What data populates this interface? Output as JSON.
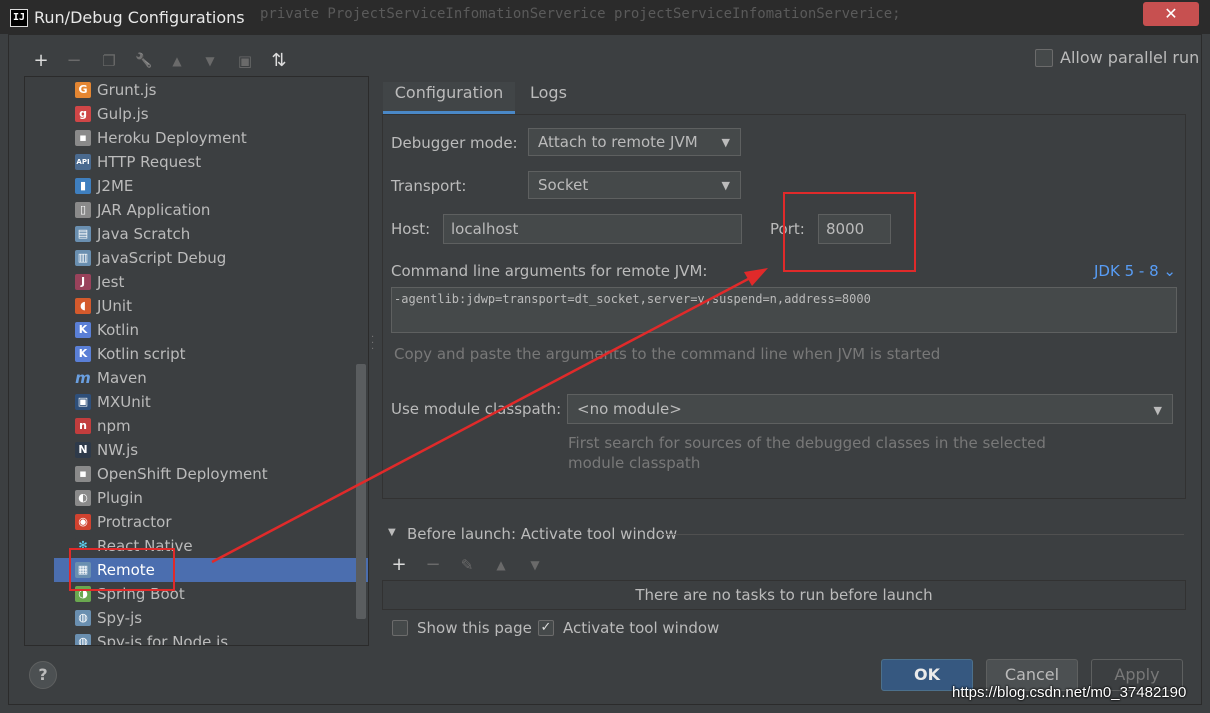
{
  "window": {
    "title": "Run/Debug Configurations",
    "app_icon": "IJ",
    "background_code_text": "private ProjectServiceInfomationServerice projectServiceInfomationServerice;",
    "close": "✕"
  },
  "toolbar": {
    "icons": [
      "add-icon",
      "remove-icon",
      "copy-icon",
      "wrench-icon",
      "move-up-icon",
      "move-down-icon",
      "folder-icon",
      "sort-icon"
    ],
    "add": "+",
    "remove": "−",
    "copy": "❐",
    "wrench": "🔧",
    "up": "▲",
    "down": "▼",
    "folder": "▣",
    "sort": "⇅"
  },
  "tree": {
    "items": [
      {
        "label": "Grunt.js",
        "icon": "grunt-icon",
        "glyph": "G",
        "color": "#e48632"
      },
      {
        "label": "Gulp.js",
        "icon": "gulp-icon",
        "glyph": "g",
        "color": "#cf4647"
      },
      {
        "label": "Heroku Deployment",
        "icon": "heroku-icon",
        "glyph": "▪",
        "color": "#8a8a8a"
      },
      {
        "label": "HTTP Request",
        "icon": "http-request-icon",
        "glyph": "API",
        "color": "#4a6a8f"
      },
      {
        "label": "J2ME",
        "icon": "j2me-icon",
        "glyph": "▮",
        "color": "#3f7fbf"
      },
      {
        "label": "JAR Application",
        "icon": "jar-icon",
        "glyph": "▯",
        "color": "#8a8a8a"
      },
      {
        "label": "Java Scratch",
        "icon": "java-scratch-icon",
        "glyph": "▤",
        "color": "#6a8fb0"
      },
      {
        "label": "JavaScript Debug",
        "icon": "js-debug-icon",
        "glyph": "▥",
        "color": "#6a8fb0"
      },
      {
        "label": "Jest",
        "icon": "jest-icon",
        "glyph": "J",
        "color": "#99425b"
      },
      {
        "label": "JUnit",
        "icon": "junit-icon",
        "glyph": "◖",
        "color": "#d45a2c"
      },
      {
        "label": "Kotlin",
        "icon": "kotlin-icon",
        "glyph": "K",
        "color": "#5a7fd6"
      },
      {
        "label": "Kotlin script",
        "icon": "kotlin-script-icon",
        "glyph": "K",
        "color": "#5a7fd6"
      },
      {
        "label": "Maven",
        "icon": "maven-icon",
        "glyph": "m",
        "color": "#3c3f41"
      },
      {
        "label": "MXUnit",
        "icon": "mxunit-icon",
        "glyph": "▣",
        "color": "#2e4f7a"
      },
      {
        "label": "npm",
        "icon": "npm-icon",
        "glyph": "n",
        "color": "#c23d3d"
      },
      {
        "label": "NW.js",
        "icon": "nwjs-icon",
        "glyph": "N",
        "color": "#2e3a4a"
      },
      {
        "label": "OpenShift Deployment",
        "icon": "openshift-icon",
        "glyph": "▪",
        "color": "#8a8a8a"
      },
      {
        "label": "Plugin",
        "icon": "plugin-icon",
        "glyph": "◐",
        "color": "#8a8a8a"
      },
      {
        "label": "Protractor",
        "icon": "protractor-icon",
        "glyph": "◉",
        "color": "#d0422f"
      },
      {
        "label": "React Native",
        "icon": "react-native-icon",
        "glyph": "✻",
        "color": "#3c3f41"
      },
      {
        "label": "Remote",
        "icon": "remote-icon",
        "glyph": "▦",
        "color": "#6a8fb0",
        "selected": true
      },
      {
        "label": "Spring Boot",
        "icon": "spring-boot-icon",
        "glyph": "◑",
        "color": "#6aa84f"
      },
      {
        "label": "Spy-js",
        "icon": "spy-js-icon",
        "glyph": "◍",
        "color": "#6a8fb0"
      },
      {
        "label": "Spy-js for Node.js",
        "icon": "spy-js-node-icon",
        "glyph": "◍",
        "color": "#6a8fb0"
      }
    ]
  },
  "right": {
    "allow_parallel_label": "Allow parallel run",
    "tabs": [
      {
        "label": "Configuration",
        "active": true
      },
      {
        "label": "Logs",
        "active": false
      }
    ],
    "debugger_mode_label": "Debugger mode:",
    "debugger_mode_value": "Attach to remote JVM",
    "transport_label": "Transport:",
    "transport_value": "Socket",
    "host_label": "Host:",
    "host_value": "localhost",
    "port_label": "Port:",
    "port_value": "8000",
    "cmd_label": "Command line arguments for remote JVM:",
    "jdk_link": "JDK 5 - 8 ⌄",
    "cmd_value": "-agentlib:jdwp=transport=dt_socket,server=y,suspend=n,address=8000",
    "cmd_hint": "Copy and paste the arguments to the command line when JVM is started",
    "module_label": "Use module classpath:",
    "module_value": "<no module>",
    "module_hint_1": "First search for sources of the debugged classes in the selected",
    "module_hint_2": "module classpath",
    "before_launch_label": "Before launch: Activate tool window",
    "no_tasks": "There are no tasks to run before launch",
    "show_page_label": "Show this page",
    "activate_tool_label": "Activate tool window",
    "activate_checked": "✓"
  },
  "buttons": {
    "ok": "OK",
    "cancel": "Cancel",
    "apply": "Apply",
    "help": "?"
  },
  "watermark": "https://blog.csdn.net/m0_37482190",
  "colors": {
    "background": "#3c3f41",
    "selection": "#4b6eaf",
    "link": "#589df6",
    "annotation": "#e02a2a"
  }
}
